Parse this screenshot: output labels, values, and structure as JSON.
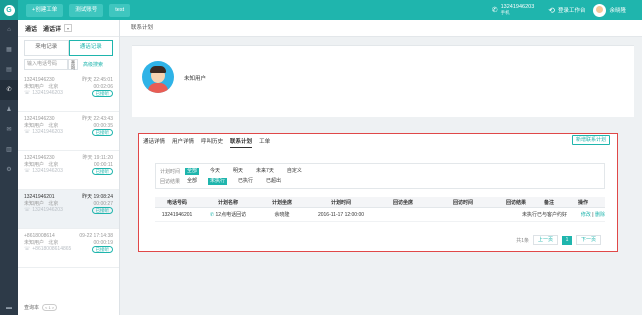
{
  "topbar": {
    "logo_glyph": "G",
    "buttons": [
      "+创建工单",
      "测试账号",
      "test"
    ],
    "phone_number": "13241946203",
    "phone_sub": "手机",
    "workbench": "登录工作台",
    "username": "余晓隆"
  },
  "list": {
    "head_a": "通话",
    "head_b": "通话详",
    "tabs": [
      "来电记录",
      "通话记录"
    ],
    "search_placeholder": "输入电话号码",
    "search_btn": "查询",
    "advanced": "高级搜索",
    "records": [
      {
        "num": "13241946230",
        "date": "昨天 22:45:01",
        "who": "未知用户",
        "loc": "北京",
        "dur": "00:02:06",
        "phone": "13241946203",
        "badge": "已接听"
      },
      {
        "num": "13241946230",
        "date": "昨天 22:43:43",
        "who": "未知用户",
        "loc": "北京",
        "dur": "00:00:35",
        "phone": "13241946203",
        "badge": "已接听"
      },
      {
        "num": "13241946230",
        "date": "昨天 19:11:20",
        "who": "未知用户",
        "loc": "北京",
        "dur": "00:00:11",
        "phone": "13241946203",
        "badge": "已接听"
      },
      {
        "num": "13241946201",
        "date": "昨天 19:08:24",
        "who": "未知用户",
        "loc": "北京",
        "dur": "00:00:27",
        "phone": "13241946203",
        "badge": "已接听"
      },
      {
        "num": "+8618008614",
        "date": "09-22 17:14:38",
        "who": "未知用户",
        "loc": "北京",
        "dur": "00:00:19",
        "phone": "+8618008614865",
        "badge": "已接听"
      }
    ],
    "footer_label": "查询本",
    "footer_pager": "< 1 >"
  },
  "main": {
    "breadcrumb": "联系计划",
    "customer_name": "未知用户",
    "tabs": [
      "通话详情",
      "用户详情",
      "呼叫历史",
      "联系计划",
      "工单"
    ],
    "new_plan": "新增联系计划",
    "filter_time_label": "计划时间",
    "filter_time_opts": [
      "全部",
      "今天",
      "明天",
      "未来7天",
      "自定义"
    ],
    "filter_result_label": "回访结果",
    "filter_result_opts": [
      "全部",
      "未执行",
      "已执行",
      "已超出"
    ],
    "columns": [
      "电话号码",
      "计划名称",
      "计划坐席",
      "计划时间",
      "回访坐席",
      "回访时间",
      "回访结果",
      "备注",
      "操作"
    ],
    "rows": [
      {
        "phone": "13241946201",
        "plan": "12点电话回访",
        "agent": "余晓隆",
        "time": "2016-11-17 12:00:00",
        "ret_agent": "",
        "ret_time": "",
        "result": "未执行",
        "note": "已与客户约好",
        "edit": "修改",
        "sep": "|",
        "del": "删除"
      }
    ],
    "pager": {
      "total": "共1条",
      "prev": "上一页",
      "page": "1",
      "next": "下一页"
    }
  }
}
